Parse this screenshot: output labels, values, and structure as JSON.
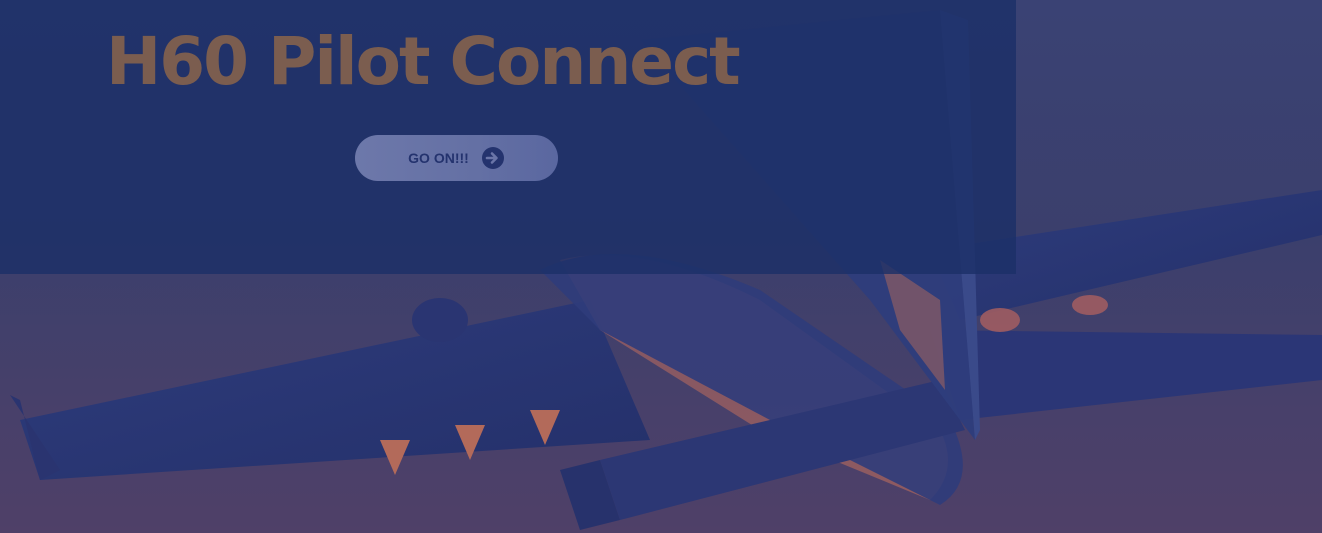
{
  "hero": {
    "title": "H60 Pilot Connect",
    "cta_label": "GO ON!!!",
    "cta_icon": "arrow-right-circle-icon",
    "background_image": "airplane-silhouette-image"
  },
  "colors": {
    "overlay": "#1c2f68",
    "title": "#7b5d4f",
    "button_bg": "#6a75a8",
    "button_text": "#24336e",
    "sky": "#3b3f6c"
  }
}
